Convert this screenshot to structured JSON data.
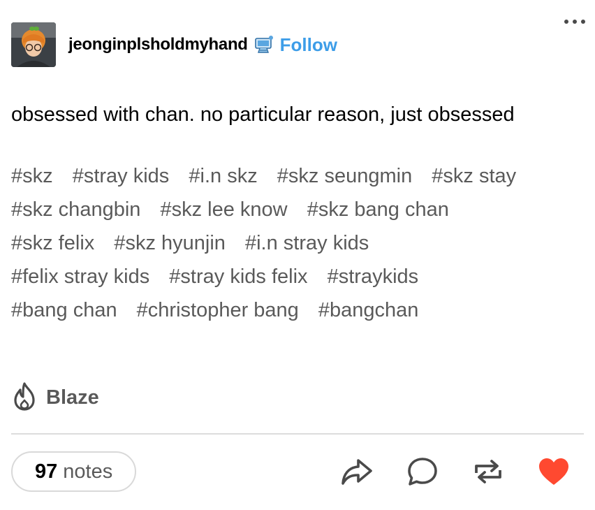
{
  "post": {
    "username": "jeonginplsholdmyhand",
    "follow_label": "Follow",
    "body": "obsessed with chan. no particular reason, just obsessed",
    "tags": [
      [
        "#skz",
        "#stray kids",
        "#i.n skz",
        "#skz seungmin",
        "#skz stay"
      ],
      [
        "#skz changbin",
        "#skz lee know",
        "#skz bang chan"
      ],
      [
        "#skz felix",
        "#skz hyunjin",
        "#i.n stray kids"
      ],
      [
        "#felix stray kids",
        "#stray kids felix",
        "#straykids"
      ],
      [
        "#bang chan",
        "#christopher bang",
        "#bangchan"
      ]
    ],
    "blaze_label": "Blaze",
    "notes_count": "97",
    "notes_label": "notes"
  },
  "icons": {
    "badge": "computer-badge-icon",
    "more": "more-icon",
    "blaze": "flame-icon",
    "share": "share-icon",
    "reply": "reply-icon",
    "reblog": "reblog-icon",
    "like": "heart-icon"
  },
  "colors": {
    "follow": "#3d9de8",
    "like": "#ff4930",
    "icon": "#4a4a4a"
  }
}
